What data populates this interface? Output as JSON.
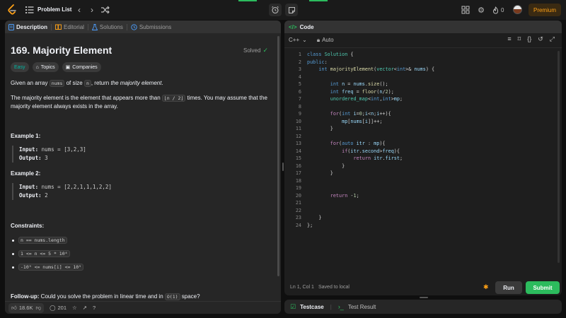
{
  "topbar": {
    "list_title": "Problem List",
    "streak_count": "0",
    "premium_label": "Premium"
  },
  "left": {
    "tabs": [
      {
        "label": "Description"
      },
      {
        "label": "Editorial"
      },
      {
        "label": "Solutions"
      },
      {
        "label": "Submissions"
      }
    ],
    "title": "169. Majority Element",
    "solved_label": "Solved",
    "tags": [
      "Easy",
      "Topics",
      "Companies"
    ],
    "desc1_a": "Given an array ",
    "desc1_code1": "nums",
    "desc1_b": " of size ",
    "desc1_code2": "n",
    "desc1_c": ", return ",
    "desc1_em": "the majority element",
    "desc1_d": ".",
    "desc2_a": "The majority element is the element that appears more than ",
    "desc2_code": "⌊n / 2⌋",
    "desc2_b": " times. You may assume that the majority element always exists in the array.",
    "example1_title": "Example 1:",
    "example1_input_label": "Input:",
    "example1_input": " nums = [3,2,3]",
    "example1_output_label": "Output:",
    "example1_output": " 3",
    "example2_title": "Example 2:",
    "example2_input_label": "Input:",
    "example2_input": " nums = [2,2,1,1,1,2,2]",
    "example2_output_label": "Output:",
    "example2_output": " 2",
    "constraints_title": "Constraints:",
    "constraints": [
      "n == nums.length",
      "1 <= n <= 5 * 10⁴",
      "-10⁹ <= nums[i] <= 10⁹"
    ],
    "followup_label": "Follow-up:",
    "followup_a": " Could you solve the problem in linear time and in ",
    "followup_code": "O(1)",
    "followup_b": " space?",
    "likes": "18.6K",
    "comments": "201"
  },
  "code": {
    "header": "Code",
    "language": "C++",
    "mode": "Auto",
    "cursor": "Ln 1, Col 1",
    "saved": "Saved to local",
    "run_label": "Run",
    "submit_label": "Submit",
    "line_numbers": [
      "1",
      "2",
      "3",
      "4",
      "5",
      "6",
      "7",
      "8",
      "9",
      "10",
      "11",
      "12",
      "13",
      "14",
      "15",
      "16",
      "17",
      "18",
      "19",
      "20",
      "21",
      "22",
      "23",
      "24"
    ]
  },
  "test": {
    "testcase_label": "Testcase",
    "result_label": "Test Result"
  },
  "colors": {
    "accent_green": "#2cbb5d",
    "premium_orange": "#ffa116",
    "easy_teal": "#00b8a3"
  }
}
